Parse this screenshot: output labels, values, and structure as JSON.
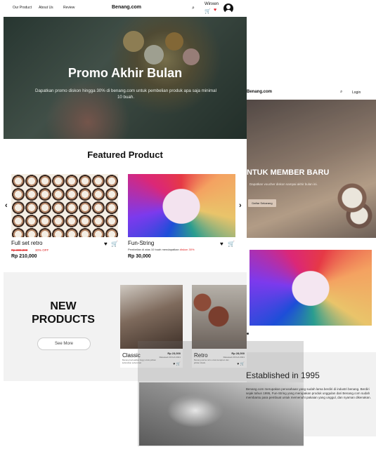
{
  "desktop": {
    "nav": {
      "links": [
        "Our Product",
        "About Us",
        "Review"
      ],
      "brand": "Benang.com",
      "username": "Winxen"
    },
    "hero": {
      "title": "Promo Akhir Bulan",
      "text": "Dapatkan promo diskon hingga 30% di benang.com untuk pembelian produk apa saja minimal 10 buah."
    },
    "featured": {
      "title": "Featured Product",
      "products": [
        {
          "name": "Full set retro",
          "old_price": "Rp 300,000",
          "discount": "30% OFF",
          "price": "Rp 210,000"
        },
        {
          "name": "Fun-String",
          "desc": "Pembelian di atas 10 buah mendapatkan",
          "desc_highlight": "diskon 30%",
          "price": "Rp 30,000"
        }
      ]
    },
    "new_products": {
      "title_line1": "NEW",
      "title_line2": "PRODUCTS",
      "button": "See More",
      "items": [
        {
          "name": "Classic",
          "price": "Rp 23,000",
          "date": "Released 20 Feb 2021",
          "desc": "Benang berkualitas tinggi untuk jahitan kebutuhan sehari-hari."
        },
        {
          "name": "Retro",
          "price": "Rp 28,000",
          "date": "Released 20 Feb 2021",
          "desc": "Benang warna retro untuk kerajinan dan jahitan klasik."
        }
      ]
    }
  },
  "mobile": {
    "nav": {
      "brand": "Benang.com",
      "login": "Login"
    },
    "hero": {
      "title": "NTUK MEMBER BARU",
      "text": "Dapatkan voucher diskon sampai akhir bulan ini.",
      "button": "Daftar Sekarang"
    },
    "established": {
      "title": "Established in 1995",
      "text": "Benang.com merupakan perusahaan yang sudah lama berdiri di industri benang. Berdiri sejak tahun 1995, Fun-String yang merupakan produk unggulan dari Benang.com sudah membantu para pembuat untuk memenuhi pakaian yang unggul, dan nyaman dikenakan."
    }
  },
  "colors": {
    "accent_red": "#e02020",
    "section_grey": "#f2f2f2"
  },
  "icons": [
    "search-icon",
    "cart-icon",
    "heart-icon",
    "avatar-icon",
    "chevron-left-icon",
    "chevron-right-icon"
  ]
}
